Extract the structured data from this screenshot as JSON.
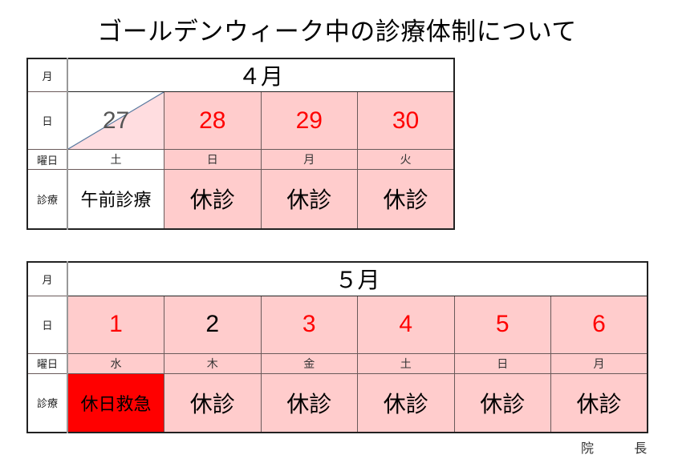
{
  "title": "ゴールデンウィーク中の診療体制について",
  "row_labels": {
    "month": "月",
    "day": "日",
    "weekday": "曜日",
    "status": "診療"
  },
  "april": {
    "month_label": "４月",
    "days": [
      {
        "day": "27",
        "weekday": "土",
        "status": "午前診療",
        "day_color": "gray",
        "weekday_color": "black",
        "bg": "white"
      },
      {
        "day": "28",
        "weekday": "日",
        "status": "休診",
        "day_color": "red",
        "weekday_color": "red",
        "bg": "pink"
      },
      {
        "day": "29",
        "weekday": "月",
        "status": "休診",
        "day_color": "red",
        "weekday_color": "black",
        "bg": "pink"
      },
      {
        "day": "30",
        "weekday": "火",
        "status": "休診",
        "day_color": "red",
        "weekday_color": "black",
        "bg": "pink"
      }
    ]
  },
  "may": {
    "month_label": "５月",
    "days": [
      {
        "day": "1",
        "weekday": "水",
        "status": "休日救急",
        "day_color": "red",
        "weekday_color": "black",
        "bg": "pink",
        "status_bg": "red"
      },
      {
        "day": "2",
        "weekday": "木",
        "status": "休診",
        "day_color": "black",
        "weekday_color": "black",
        "bg": "pink"
      },
      {
        "day": "3",
        "weekday": "金",
        "status": "休診",
        "day_color": "red",
        "weekday_color": "black",
        "bg": "pink"
      },
      {
        "day": "4",
        "weekday": "土",
        "status": "休診",
        "day_color": "red",
        "weekday_color": "black",
        "bg": "pink"
      },
      {
        "day": "5",
        "weekday": "日",
        "status": "休診",
        "day_color": "red",
        "weekday_color": "red",
        "bg": "pink"
      },
      {
        "day": "6",
        "weekday": "月",
        "status": "休診",
        "day_color": "red",
        "weekday_color": "black",
        "bg": "pink"
      }
    ]
  },
  "signature": {
    "part1": "院",
    "part2": "長"
  },
  "colors": {
    "pink": "#ffcccc",
    "red": "#ff0000",
    "white": "#ffffff"
  }
}
